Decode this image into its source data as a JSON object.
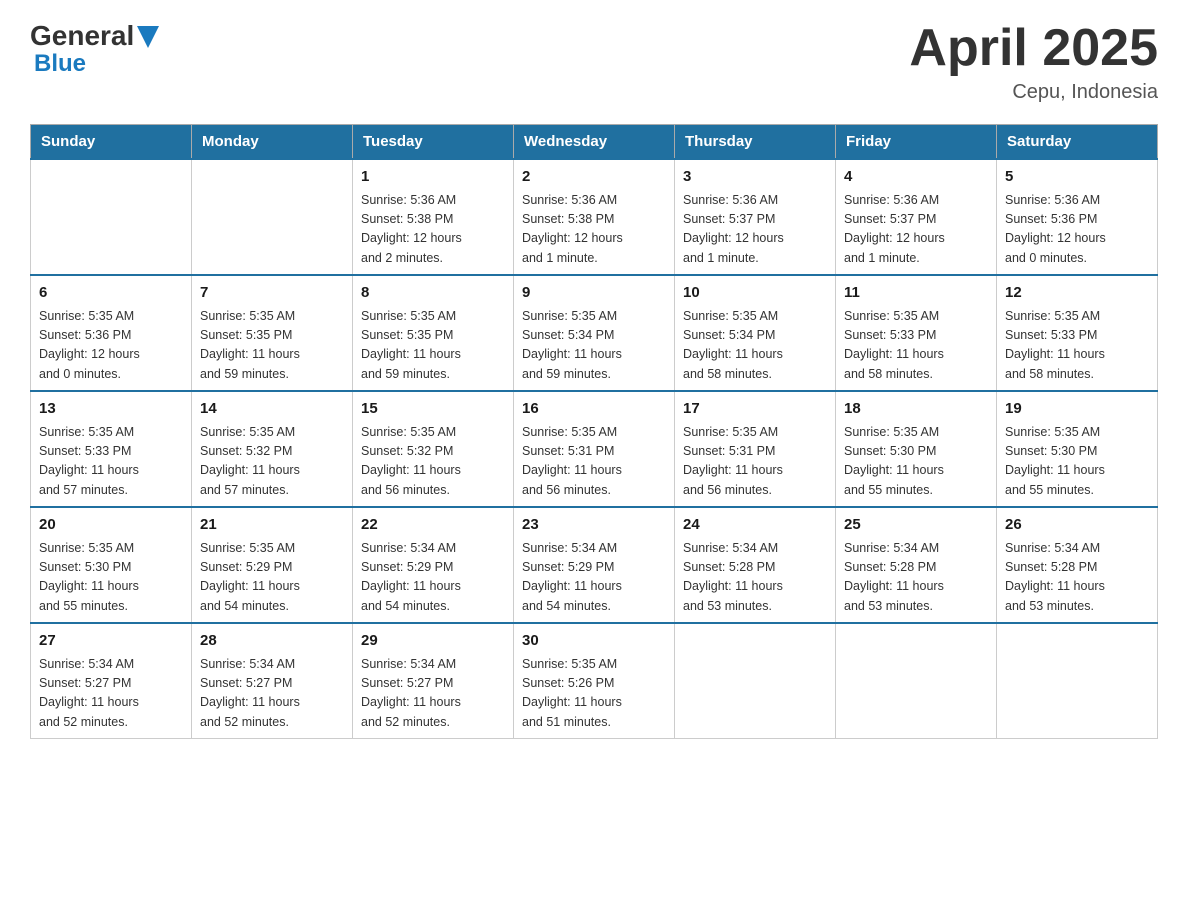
{
  "header": {
    "logo_general": "General",
    "logo_blue": "Blue",
    "month_year": "April 2025",
    "location": "Cepu, Indonesia"
  },
  "weekdays": [
    "Sunday",
    "Monday",
    "Tuesday",
    "Wednesday",
    "Thursday",
    "Friday",
    "Saturday"
  ],
  "weeks": [
    [
      {
        "day": "",
        "info": ""
      },
      {
        "day": "",
        "info": ""
      },
      {
        "day": "1",
        "info": "Sunrise: 5:36 AM\nSunset: 5:38 PM\nDaylight: 12 hours\nand 2 minutes."
      },
      {
        "day": "2",
        "info": "Sunrise: 5:36 AM\nSunset: 5:38 PM\nDaylight: 12 hours\nand 1 minute."
      },
      {
        "day": "3",
        "info": "Sunrise: 5:36 AM\nSunset: 5:37 PM\nDaylight: 12 hours\nand 1 minute."
      },
      {
        "day": "4",
        "info": "Sunrise: 5:36 AM\nSunset: 5:37 PM\nDaylight: 12 hours\nand 1 minute."
      },
      {
        "day": "5",
        "info": "Sunrise: 5:36 AM\nSunset: 5:36 PM\nDaylight: 12 hours\nand 0 minutes."
      }
    ],
    [
      {
        "day": "6",
        "info": "Sunrise: 5:35 AM\nSunset: 5:36 PM\nDaylight: 12 hours\nand 0 minutes."
      },
      {
        "day": "7",
        "info": "Sunrise: 5:35 AM\nSunset: 5:35 PM\nDaylight: 11 hours\nand 59 minutes."
      },
      {
        "day": "8",
        "info": "Sunrise: 5:35 AM\nSunset: 5:35 PM\nDaylight: 11 hours\nand 59 minutes."
      },
      {
        "day": "9",
        "info": "Sunrise: 5:35 AM\nSunset: 5:34 PM\nDaylight: 11 hours\nand 59 minutes."
      },
      {
        "day": "10",
        "info": "Sunrise: 5:35 AM\nSunset: 5:34 PM\nDaylight: 11 hours\nand 58 minutes."
      },
      {
        "day": "11",
        "info": "Sunrise: 5:35 AM\nSunset: 5:33 PM\nDaylight: 11 hours\nand 58 minutes."
      },
      {
        "day": "12",
        "info": "Sunrise: 5:35 AM\nSunset: 5:33 PM\nDaylight: 11 hours\nand 58 minutes."
      }
    ],
    [
      {
        "day": "13",
        "info": "Sunrise: 5:35 AM\nSunset: 5:33 PM\nDaylight: 11 hours\nand 57 minutes."
      },
      {
        "day": "14",
        "info": "Sunrise: 5:35 AM\nSunset: 5:32 PM\nDaylight: 11 hours\nand 57 minutes."
      },
      {
        "day": "15",
        "info": "Sunrise: 5:35 AM\nSunset: 5:32 PM\nDaylight: 11 hours\nand 56 minutes."
      },
      {
        "day": "16",
        "info": "Sunrise: 5:35 AM\nSunset: 5:31 PM\nDaylight: 11 hours\nand 56 minutes."
      },
      {
        "day": "17",
        "info": "Sunrise: 5:35 AM\nSunset: 5:31 PM\nDaylight: 11 hours\nand 56 minutes."
      },
      {
        "day": "18",
        "info": "Sunrise: 5:35 AM\nSunset: 5:30 PM\nDaylight: 11 hours\nand 55 minutes."
      },
      {
        "day": "19",
        "info": "Sunrise: 5:35 AM\nSunset: 5:30 PM\nDaylight: 11 hours\nand 55 minutes."
      }
    ],
    [
      {
        "day": "20",
        "info": "Sunrise: 5:35 AM\nSunset: 5:30 PM\nDaylight: 11 hours\nand 55 minutes."
      },
      {
        "day": "21",
        "info": "Sunrise: 5:35 AM\nSunset: 5:29 PM\nDaylight: 11 hours\nand 54 minutes."
      },
      {
        "day": "22",
        "info": "Sunrise: 5:34 AM\nSunset: 5:29 PM\nDaylight: 11 hours\nand 54 minutes."
      },
      {
        "day": "23",
        "info": "Sunrise: 5:34 AM\nSunset: 5:29 PM\nDaylight: 11 hours\nand 54 minutes."
      },
      {
        "day": "24",
        "info": "Sunrise: 5:34 AM\nSunset: 5:28 PM\nDaylight: 11 hours\nand 53 minutes."
      },
      {
        "day": "25",
        "info": "Sunrise: 5:34 AM\nSunset: 5:28 PM\nDaylight: 11 hours\nand 53 minutes."
      },
      {
        "day": "26",
        "info": "Sunrise: 5:34 AM\nSunset: 5:28 PM\nDaylight: 11 hours\nand 53 minutes."
      }
    ],
    [
      {
        "day": "27",
        "info": "Sunrise: 5:34 AM\nSunset: 5:27 PM\nDaylight: 11 hours\nand 52 minutes."
      },
      {
        "day": "28",
        "info": "Sunrise: 5:34 AM\nSunset: 5:27 PM\nDaylight: 11 hours\nand 52 minutes."
      },
      {
        "day": "29",
        "info": "Sunrise: 5:34 AM\nSunset: 5:27 PM\nDaylight: 11 hours\nand 52 minutes."
      },
      {
        "day": "30",
        "info": "Sunrise: 5:35 AM\nSunset: 5:26 PM\nDaylight: 11 hours\nand 51 minutes."
      },
      {
        "day": "",
        "info": ""
      },
      {
        "day": "",
        "info": ""
      },
      {
        "day": "",
        "info": ""
      }
    ]
  ]
}
